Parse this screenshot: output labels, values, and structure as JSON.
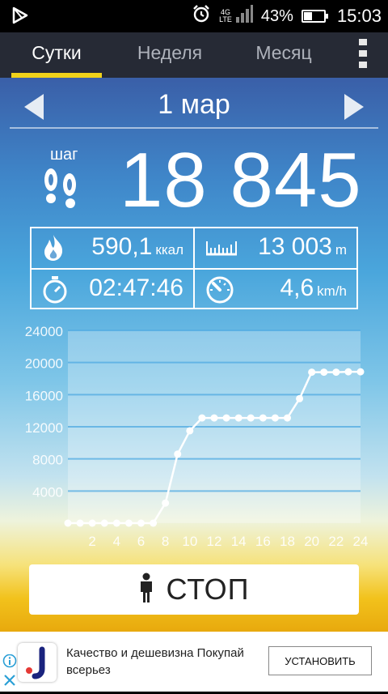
{
  "status_bar": {
    "network": "4G",
    "network_sub": "LTE",
    "battery_percent": "43%",
    "battery_level": 0.43,
    "time": "15:03"
  },
  "tabs": [
    {
      "label": "Сутки",
      "active": true
    },
    {
      "label": "Неделя",
      "active": false
    },
    {
      "label": "Месяц",
      "active": false
    }
  ],
  "date_nav": {
    "date": "1 мар"
  },
  "steps": {
    "label": "шаг",
    "value": "18 845"
  },
  "stats": {
    "calories": {
      "value": "590,1",
      "unit": "ккал"
    },
    "distance": {
      "value": "13 003",
      "unit": "m"
    },
    "duration": {
      "value": "02:47:46",
      "unit": ""
    },
    "speed": {
      "value": "4,6",
      "unit": "km/h"
    }
  },
  "chart_data": {
    "type": "line",
    "title": "",
    "xlabel": "",
    "ylabel": "",
    "ylim": [
      0,
      24000
    ],
    "xlim": [
      0,
      24
    ],
    "y_ticks": [
      4000,
      8000,
      12000,
      16000,
      20000,
      24000
    ],
    "x_ticks": [
      2,
      4,
      6,
      8,
      10,
      12,
      14,
      16,
      18,
      20,
      22,
      24
    ],
    "grid": true,
    "x": [
      0,
      1,
      2,
      3,
      4,
      5,
      6,
      7,
      8,
      9,
      10,
      11,
      12,
      13,
      14,
      15,
      16,
      17,
      18,
      19,
      20,
      21,
      22,
      23,
      24
    ],
    "values": [
      0,
      0,
      0,
      0,
      0,
      0,
      0,
      0,
      2500,
      8600,
      11500,
      13100,
      13100,
      13100,
      13100,
      13100,
      13100,
      13100,
      13100,
      15500,
      18800,
      18800,
      18800,
      18845,
      18845
    ]
  },
  "stop_button": {
    "label": "СТОП"
  },
  "ad": {
    "text": "Качество и дешевизна Покупай всерьез",
    "button": "УСТАНОВИТЬ"
  },
  "colors": {
    "tab_bar": "#262a35",
    "tab_indicator": "#f0d21a",
    "chart_line": "#ffffff"
  }
}
